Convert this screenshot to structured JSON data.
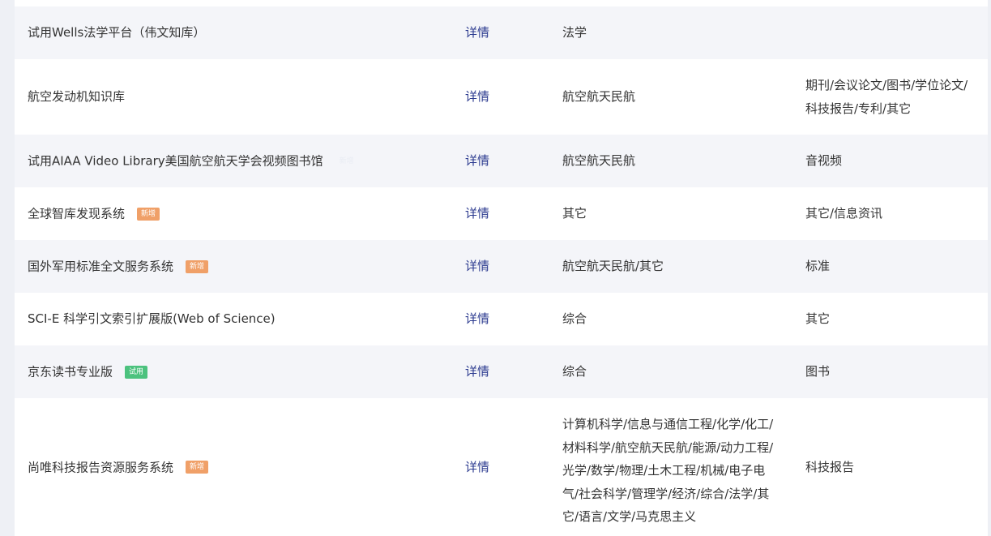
{
  "rows": [
    {
      "name": "试用Wells法学平台（伟文知库）",
      "badge": "",
      "detail": "详情",
      "subject": "法学",
      "type": ""
    },
    {
      "name": "航空发动机知识库",
      "badge": "",
      "detail": "详情",
      "subject": "航空航天民航",
      "type": "期刊/会议论文/图书/学位论文/科技报告/专利/其它"
    },
    {
      "name": "试用AIAA Video Library美国航空航天学会视频图书馆",
      "badge": "新增",
      "detail": "详情",
      "subject": "航空航天民航",
      "type": "音视频"
    },
    {
      "name": "全球智库发现系统",
      "badge": "新增",
      "detail": "详情",
      "subject": "其它",
      "type": "其它/信息资讯"
    },
    {
      "name": "国外军用标准全文服务系统",
      "badge": "新增",
      "detail": "详情",
      "subject": "航空航天民航/其它",
      "type": "标准"
    },
    {
      "name": "SCI-E 科学引文索引扩展版(Web of Science)",
      "badge": "",
      "detail": "详情",
      "subject": "综合",
      "type": "其它"
    },
    {
      "name": "京东读书专业版",
      "badge": "试用",
      "detail": "详情",
      "subject": "综合",
      "type": "图书"
    },
    {
      "name": "尚唯科技报告资源服务系统",
      "badge": "新增",
      "detail": "详情",
      "subject": "计算机科学/信息与通信工程/化学/化工/材料科学/航空航天民航/能源/动力工程/光学/数学/物理/土木工程/机械/电子电气/社会科学/管理学/经济/综合/法学/其它/语言/文学/马克思主义",
      "type": "科技报告"
    }
  ],
  "colors": {
    "badge_new": "#f0a068",
    "badge_trial": "#4cc27e",
    "link": "#2b3a8f",
    "row_alt": "#f4f5f9",
    "row_white": "#ffffff"
  }
}
